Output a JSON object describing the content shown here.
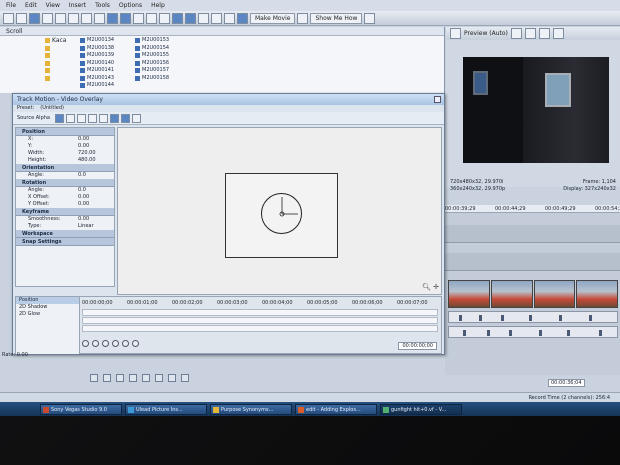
{
  "menu": [
    "File",
    "Edit",
    "View",
    "Insert",
    "Tools",
    "Options",
    "Help"
  ],
  "toolbar": {
    "make_movie": "Make Movie",
    "show_me_how": "Show Me How"
  },
  "explorer": {
    "path": "Scroll",
    "folder_label": "Kaca",
    "files_col1": [
      "M2U00134",
      "M2U00138",
      "M2U00139",
      "M2U00140",
      "M2U00141",
      "M2U00143",
      "M2U00144"
    ],
    "files_col2": [
      "M2U00153",
      "M2U00154",
      "M2U00155",
      "M2U00156",
      "M2U00157",
      "M2U00158"
    ]
  },
  "preview": {
    "mode": "Preview (Auto)",
    "project": "720x480x32, 29.970i",
    "preview_res": "360x240x32, 29.970p",
    "frame_label": "Frame:",
    "frame_value": "1,104",
    "display_label": "Display:",
    "display_value": "327x240x32"
  },
  "dialog": {
    "title": "Track Motion - Video Overlay",
    "preset_label": "Preset:",
    "preset_value": "(Untitled)",
    "source_alpha": "Source Alpha",
    "sections": {
      "position": "Position",
      "orientation": "Orientation",
      "rotation": "Rotation",
      "keyframe": "Keyframe",
      "workspace": "Workspace",
      "snap": "Snap Settings"
    },
    "position_rows": [
      {
        "k": "X:",
        "v": "0.00"
      },
      {
        "k": "Y:",
        "v": "0.00"
      },
      {
        "k": "Width:",
        "v": "720.00"
      },
      {
        "k": "Height:",
        "v": "480.00"
      }
    ],
    "orientation_rows": [
      {
        "k": "Angle:",
        "v": "0.0"
      }
    ],
    "rotation_rows": [
      {
        "k": "Angle:",
        "v": "0.0"
      },
      {
        "k": "X Offset:",
        "v": "0.00"
      },
      {
        "k": "Y Offset:",
        "v": "0.00"
      }
    ],
    "keyframe_rows": [
      {
        "k": "Smoothness:",
        "v": "0.00"
      },
      {
        "k": "Type:",
        "v": "Linear"
      }
    ],
    "kf_list": [
      "Position",
      "2D Shadow",
      "2D Glow"
    ],
    "kf_ruler": [
      "00:00:00;00",
      "00:00:01;00",
      "00:00:02;00",
      "00:00:03;00",
      "00:00:04;00",
      "00:00:05;00",
      "00:00:06;00",
      "00:00:07;00"
    ],
    "kf_time": "00:00:00;00"
  },
  "timeline": {
    "ruler": [
      "00:00:39;29",
      "00:00:44;29",
      "00:00:49;29",
      "00:00:54;29",
      "00:00:59;28"
    ]
  },
  "rate": "Rate: 0.00",
  "timecode": "00:00:36;04",
  "status": {
    "record_time": "Record Time (2 channels): 256:4"
  },
  "taskbar": [
    "Sony Vegas Studio 9.0",
    "Ulead Picture Ins...",
    "Purpose Synonyms...",
    "edit - Adding Explos...",
    "gunfight hit+0.vf - V..."
  ]
}
